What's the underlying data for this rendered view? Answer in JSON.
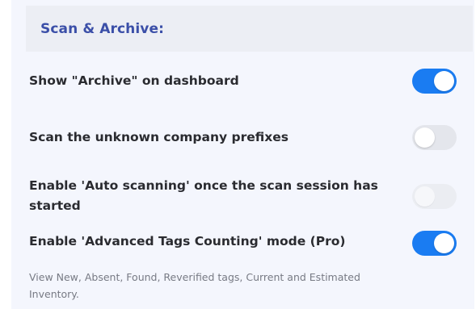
{
  "section": {
    "title": "Scan & Archive:"
  },
  "settings": [
    {
      "label": "Show \"Archive\" on dashboard",
      "state": "on"
    },
    {
      "label": "Scan the unknown company prefixes",
      "state": "off"
    },
    {
      "label": "Enable 'Auto scanning' once the scan session has started",
      "state": "disabled"
    },
    {
      "label": "Enable 'Advanced Tags Counting' mode (Pro)",
      "state": "on",
      "hint": "View New, Absent, Found, Reverified tags, Current and Estimated Inventory."
    }
  ],
  "colors": {
    "accent": "#1a7cf2",
    "title": "#3b4fa8",
    "panel_bg": "#f4f6fd"
  }
}
